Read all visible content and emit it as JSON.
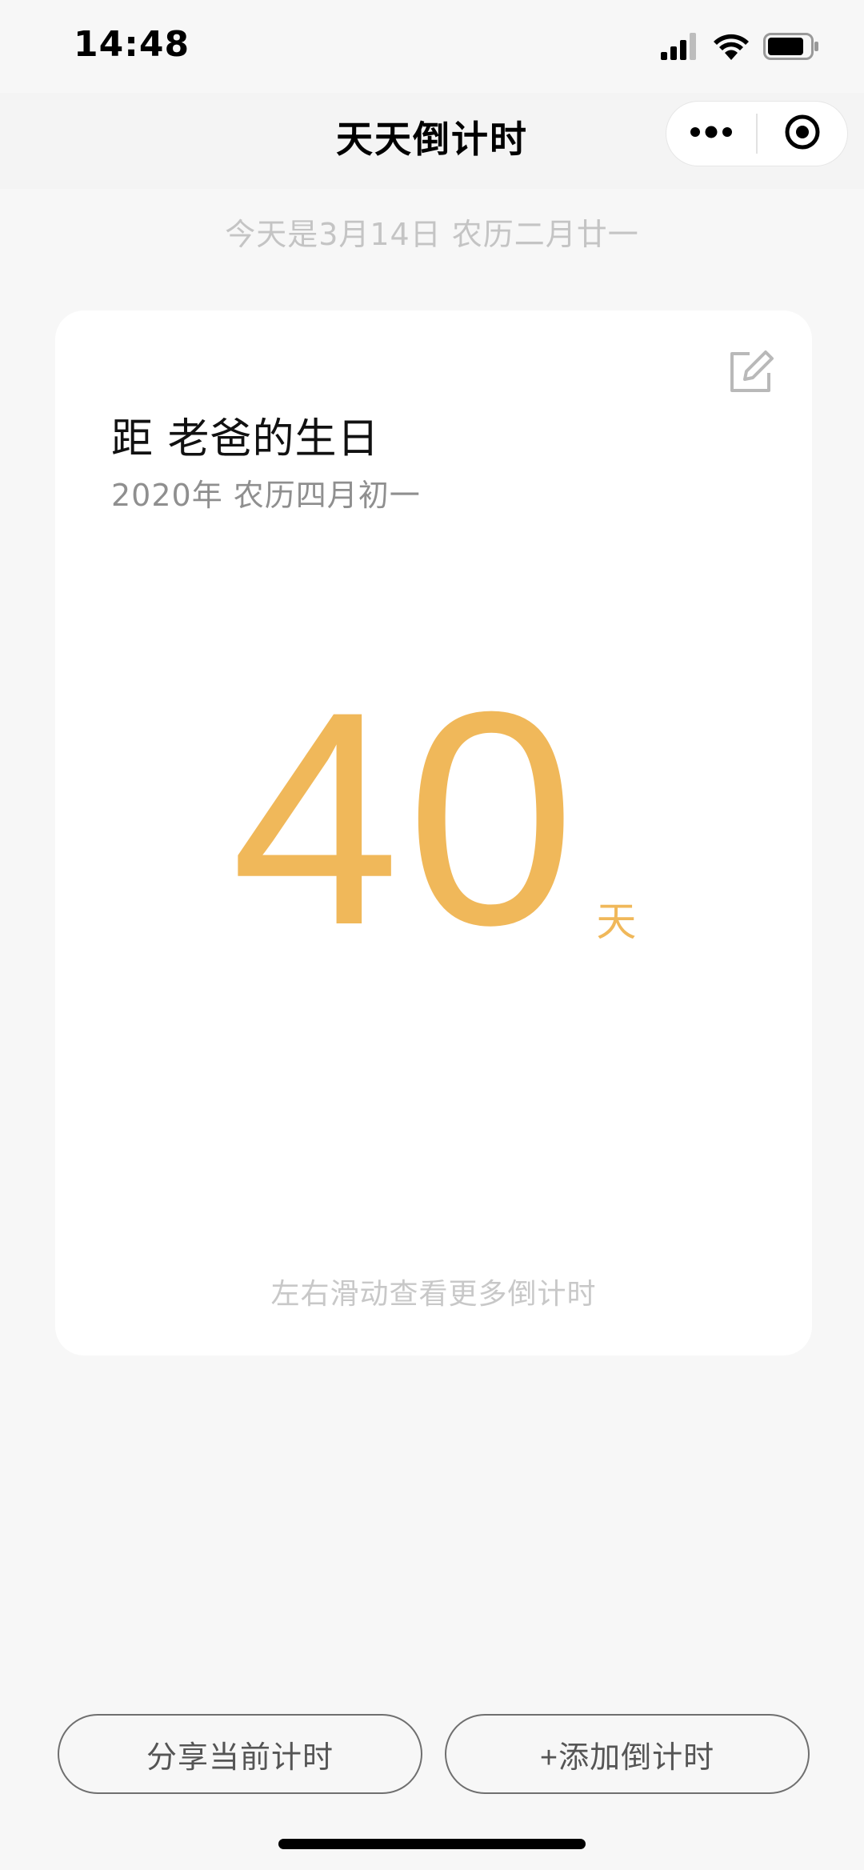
{
  "status_bar": {
    "time": "14:48",
    "icons": [
      "signal-icon",
      "wifi-icon",
      "battery-icon"
    ]
  },
  "nav": {
    "title": "天天倒计时",
    "capsule": {
      "more_icon": "more-dots-icon",
      "close_icon": "target-circle-icon"
    }
  },
  "today_text": "今天是3月14日 农历二月廿一",
  "card": {
    "edit_icon": "edit-icon",
    "title": "距 老爸的生日",
    "subtitle": "2020年 农历四月初一",
    "count": "40",
    "unit": "天",
    "hint": "左右滑动查看更多倒计时"
  },
  "buttons": {
    "share_label": "分享当前计时",
    "add_label": "+添加倒计时"
  },
  "colors": {
    "accent": "#f0b85a",
    "background": "#f7f7f7",
    "card": "#ffffff"
  }
}
